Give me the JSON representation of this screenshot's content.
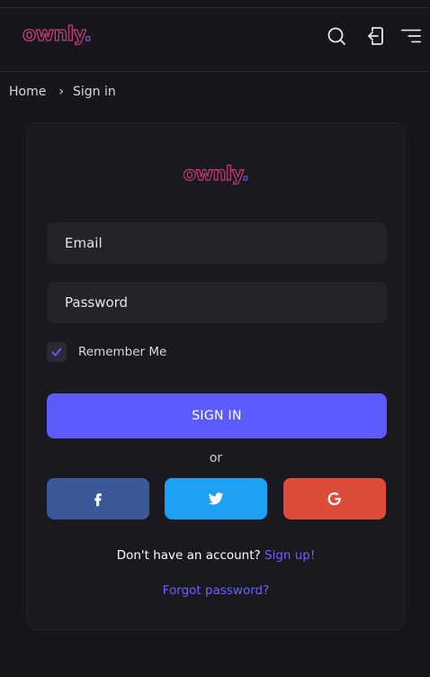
{
  "header": {
    "logo": {
      "main": "ownly",
      "dot": "."
    },
    "icons": [
      "search-icon",
      "login-icon",
      "menu-icon"
    ]
  },
  "breadcrumb": {
    "home": "Home",
    "current": "Sign in"
  },
  "card": {
    "logo": {
      "main": "ownly",
      "dot": "."
    },
    "email_placeholder": "Email",
    "password_placeholder": "Password",
    "remember_label": "Remember Me",
    "remember_checked": true,
    "signin_label": "SIGN IN",
    "or_text": "or",
    "social": [
      {
        "name": "facebook",
        "icon": "facebook-icon",
        "color": "#3b5998"
      },
      {
        "name": "twitter",
        "icon": "twitter-icon",
        "color": "#1da1f2"
      },
      {
        "name": "google",
        "icon": "google-icon",
        "color": "#dd4b39"
      }
    ],
    "account_text": "Don't have an account?",
    "signup_link": "Sign up!",
    "forgot_link": "Forgot password?"
  },
  "colors": {
    "background": "#17161c",
    "accent": "#5b5bff",
    "link": "#6a62ff",
    "logo_pink": "#c13e7a",
    "logo_purple": "#7b4ae0"
  }
}
